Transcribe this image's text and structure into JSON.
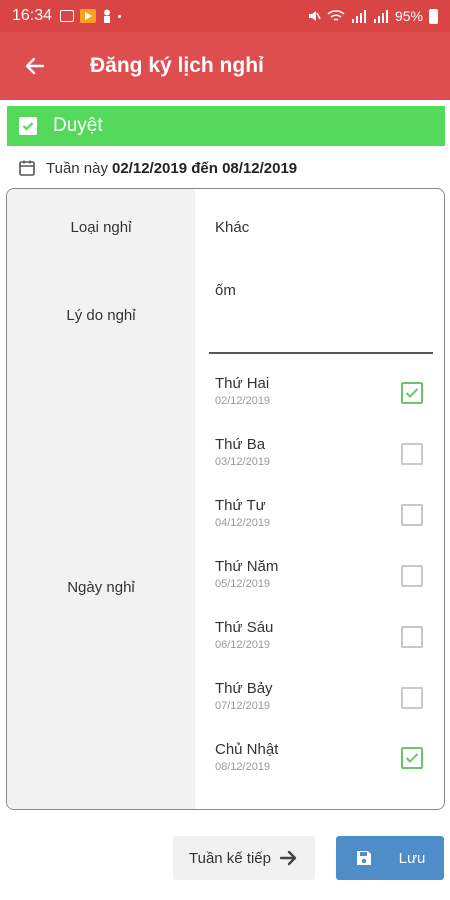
{
  "status_bar": {
    "time": "16:34",
    "battery": "95%",
    "icons": [
      "image-icon",
      "play-icon",
      "person-icon",
      "mute-icon",
      "wifi-icon",
      "signal-icon",
      "battery-icon"
    ]
  },
  "app_bar": {
    "title": "Đăng ký lịch nghỉ",
    "back_icon": "arrow-left-icon",
    "color": "#df4e4e"
  },
  "banner": {
    "label": "Duyệt",
    "color": "#55d95a",
    "checked": true
  },
  "week": {
    "prefix": "Tuần này",
    "range": "02/12/2019 đến 08/12/2019"
  },
  "form": {
    "leave_type_label": "Loại nghỉ",
    "leave_type_value": "Khác",
    "reason_label": "Lý do nghỉ",
    "reason_value": "ốm",
    "days_label": "Ngày nghỉ",
    "days": [
      {
        "name": "Thứ Hai",
        "date": "02/12/2019",
        "checked": true
      },
      {
        "name": "Thứ Ba",
        "date": "03/12/2019",
        "checked": false
      },
      {
        "name": "Thứ Tư",
        "date": "04/12/2019",
        "checked": false
      },
      {
        "name": "Thứ Năm",
        "date": "05/12/2019",
        "checked": false
      },
      {
        "name": "Thứ Sáu",
        "date": "06/12/2019",
        "checked": false
      },
      {
        "name": "Thứ Bảy",
        "date": "07/12/2019",
        "checked": false
      },
      {
        "name": "Chủ Nhật",
        "date": "08/12/2019",
        "checked": true
      }
    ]
  },
  "actions": {
    "next_week_label": "Tuần kế tiếp",
    "save_label": "Lưu",
    "save_color": "#4e8dc7"
  }
}
